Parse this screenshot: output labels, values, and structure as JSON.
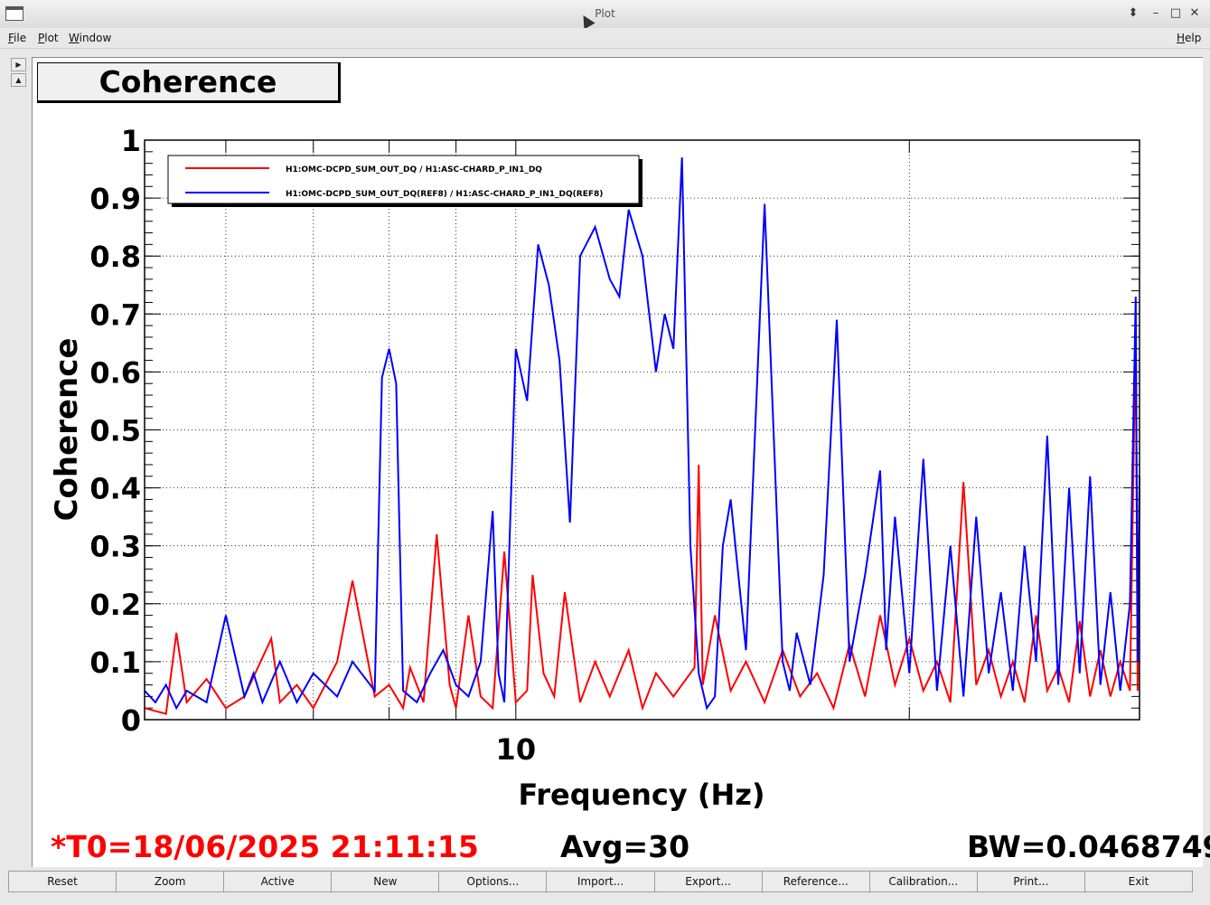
{
  "window": {
    "title": "Plot"
  },
  "menu": {
    "file": "File",
    "plot": "Plot",
    "window": "Window",
    "help": "Help"
  },
  "plot_title": "Coherence",
  "status": {
    "t0": "*T0=18/06/2025 21:11:15",
    "avg": "Avg=30",
    "bw": "BW=0.0468749"
  },
  "buttons": [
    "Reset",
    "Zoom",
    "Active",
    "New",
    "Options...",
    "Import...",
    "Export...",
    "Reference...",
    "Calibration...",
    "Print...",
    "Exit"
  ],
  "colors": {
    "red_series": "#ff0000",
    "blue_series": "#0000ff"
  },
  "chart_data": {
    "type": "line",
    "xlabel": "Frequency (Hz)",
    "ylabel": "Coherence",
    "xscale": "log",
    "xlim": [
      5.2,
      30
    ],
    "ylim": [
      0,
      1
    ],
    "yticks": [
      "0",
      "0.1",
      "0.2",
      "0.3",
      "0.4",
      "0.5",
      "0.6",
      "0.7",
      "0.8",
      "0.9",
      "1"
    ],
    "xticks": [
      "10"
    ],
    "grid": true,
    "legend": "top-left",
    "series": [
      {
        "name": "H1:OMC-DCPD_SUM_OUT_DQ / H1:ASC-CHARD_P_IN1_DQ",
        "color": "#ff0000",
        "x": [
          5.2,
          5.4,
          5.5,
          5.6,
          5.8,
          6.0,
          6.2,
          6.5,
          6.6,
          6.8,
          7.0,
          7.3,
          7.5,
          7.8,
          8.0,
          8.2,
          8.3,
          8.5,
          8.7,
          8.9,
          9.0,
          9.2,
          9.4,
          9.6,
          9.8,
          10.0,
          10.2,
          10.3,
          10.5,
          10.7,
          10.9,
          11.2,
          11.5,
          11.8,
          12.2,
          12.5,
          12.8,
          13.2,
          13.7,
          13.8,
          13.9,
          14.2,
          14.6,
          15.0,
          15.5,
          16.0,
          16.5,
          17.0,
          17.5,
          18.0,
          18.5,
          19.0,
          19.5,
          20.0,
          20.5,
          21.0,
          21.5,
          22.0,
          22.5,
          23.0,
          23.5,
          24.0,
          24.5,
          25.0,
          25.5,
          26.0,
          26.5,
          27.0,
          27.5,
          28.0,
          28.5,
          29.0,
          29.5,
          29.8,
          29.9,
          30.0
        ],
        "y": [
          0.02,
          0.01,
          0.15,
          0.03,
          0.07,
          0.02,
          0.04,
          0.14,
          0.03,
          0.06,
          0.02,
          0.1,
          0.24,
          0.04,
          0.06,
          0.02,
          0.09,
          0.03,
          0.32,
          0.06,
          0.02,
          0.18,
          0.04,
          0.02,
          0.29,
          0.03,
          0.05,
          0.25,
          0.08,
          0.04,
          0.22,
          0.03,
          0.1,
          0.04,
          0.12,
          0.02,
          0.08,
          0.04,
          0.09,
          0.44,
          0.06,
          0.18,
          0.05,
          0.1,
          0.03,
          0.12,
          0.04,
          0.08,
          0.02,
          0.13,
          0.04,
          0.18,
          0.06,
          0.14,
          0.05,
          0.1,
          0.03,
          0.41,
          0.06,
          0.12,
          0.04,
          0.1,
          0.03,
          0.18,
          0.05,
          0.09,
          0.03,
          0.17,
          0.04,
          0.12,
          0.04,
          0.1,
          0.05,
          0.68,
          0.05,
          0.4
        ]
      },
      {
        "name": "H1:OMC-DCPD_SUM_OUT_DQ(REF8) / H1:ASC-CHARD_P_IN1_DQ(REF8)",
        "color": "#0000ff",
        "x": [
          5.2,
          5.3,
          5.4,
          5.5,
          5.6,
          5.8,
          6.0,
          6.2,
          6.3,
          6.4,
          6.6,
          6.8,
          7.0,
          7.3,
          7.5,
          7.8,
          7.9,
          8.0,
          8.1,
          8.2,
          8.4,
          8.6,
          8.8,
          9.0,
          9.2,
          9.4,
          9.6,
          9.7,
          9.8,
          10.0,
          10.2,
          10.4,
          10.6,
          10.8,
          11.0,
          11.2,
          11.5,
          11.8,
          12.0,
          12.2,
          12.5,
          12.8,
          13.0,
          13.2,
          13.4,
          13.6,
          13.8,
          14.0,
          14.2,
          14.4,
          14.6,
          15.0,
          15.5,
          16.0,
          16.2,
          16.4,
          16.8,
          17.2,
          17.6,
          18.0,
          18.5,
          19.0,
          19.2,
          19.5,
          20.0,
          20.5,
          21.0,
          21.5,
          22.0,
          22.5,
          23.0,
          23.5,
          24.0,
          24.5,
          25.0,
          25.5,
          26.0,
          26.5,
          27.0,
          27.5,
          28.0,
          28.5,
          29.0,
          29.5,
          29.8,
          29.9,
          30.0
        ],
        "y": [
          0.05,
          0.03,
          0.06,
          0.02,
          0.05,
          0.03,
          0.18,
          0.04,
          0.08,
          0.03,
          0.1,
          0.03,
          0.08,
          0.04,
          0.1,
          0.05,
          0.59,
          0.64,
          0.58,
          0.05,
          0.03,
          0.08,
          0.12,
          0.06,
          0.04,
          0.1,
          0.36,
          0.08,
          0.03,
          0.64,
          0.55,
          0.82,
          0.75,
          0.62,
          0.34,
          0.8,
          0.85,
          0.76,
          0.73,
          0.88,
          0.8,
          0.6,
          0.7,
          0.64,
          0.97,
          0.3,
          0.08,
          0.02,
          0.04,
          0.3,
          0.38,
          0.12,
          0.89,
          0.1,
          0.05,
          0.15,
          0.06,
          0.25,
          0.69,
          0.1,
          0.25,
          0.43,
          0.12,
          0.35,
          0.08,
          0.45,
          0.05,
          0.3,
          0.04,
          0.35,
          0.08,
          0.22,
          0.05,
          0.3,
          0.1,
          0.49,
          0.06,
          0.4,
          0.08,
          0.42,
          0.06,
          0.22,
          0.05,
          0.2,
          0.73,
          0.1,
          0.42
        ]
      }
    ]
  }
}
